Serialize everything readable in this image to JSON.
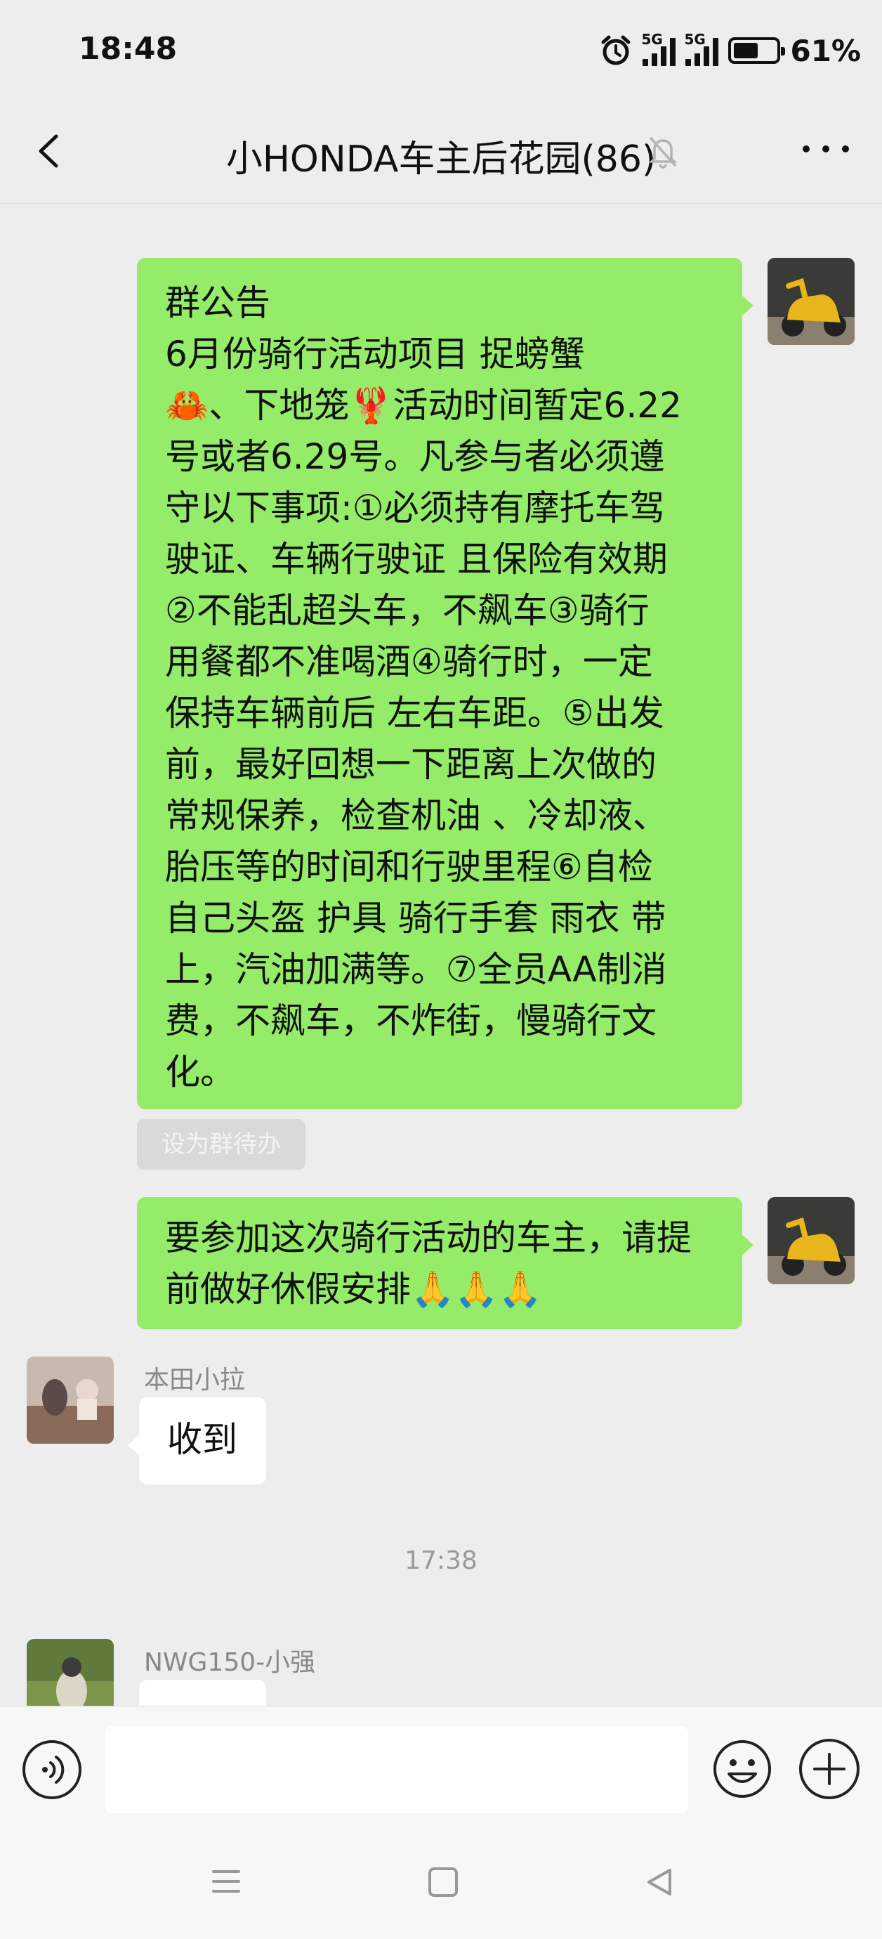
{
  "status": {
    "time": "18:48",
    "network1": "5G",
    "network2": "5G",
    "battery": "61%",
    "battery_level": 0.61
  },
  "header": {
    "title": "小HONDA车主后花园(86)",
    "back_icon": "chevron-left-icon",
    "mute_icon": "bell-off-icon",
    "more_icon": "more-horizontal-icon"
  },
  "messages": [
    {
      "lines": [
        "群公告",
        "6月份骑行活动项目        捉螃蟹",
        "🦀、下地笼🦞活动时间暂定6.22",
        "号或者6.29号。凡参与者必须遵",
        "守以下事项:①必须持有摩托车驾",
        "驶证、车辆行驶证 且保险有效期",
        "②不能乱超头车，不飙车③骑行",
        "用餐都不准喝酒④骑行时，一定",
        "保持车辆前后  左右车距。⑤出发",
        "前，最好回想一下距离上次做的",
        "常规保养，检查机油 、冷却液、",
        "胎压等的时间和行驶里程⑥自检",
        "自己头盔  护具  骑行手套   雨衣 带",
        "上，汽油加满等。⑦全员AA制消",
        "费，不飙车，不炸街，慢骑行文",
        "化。"
      ]
    },
    {
      "lines": [
        "要参加这次骑行活动的车主，请提",
        "前做好休假安排🙏🙏🙏"
      ]
    },
    {
      "sender": "本田小拉",
      "text": "收到"
    },
    {
      "sender": "NWG150-小强"
    }
  ],
  "todo_button": "设为群待办",
  "time_separator": "17:38",
  "input": {
    "placeholder": "",
    "voice_icon": "voice-icon",
    "emoji_icon": "emoji-icon",
    "plus_icon": "plus-icon"
  },
  "nav": {
    "menu_icon": "menu-icon",
    "home_icon": "home-square-icon",
    "back_icon": "back-triangle-icon"
  },
  "colors": {
    "self_bubble": "#95ec69",
    "other_bubble": "#ffffff",
    "background": "#ededed"
  }
}
